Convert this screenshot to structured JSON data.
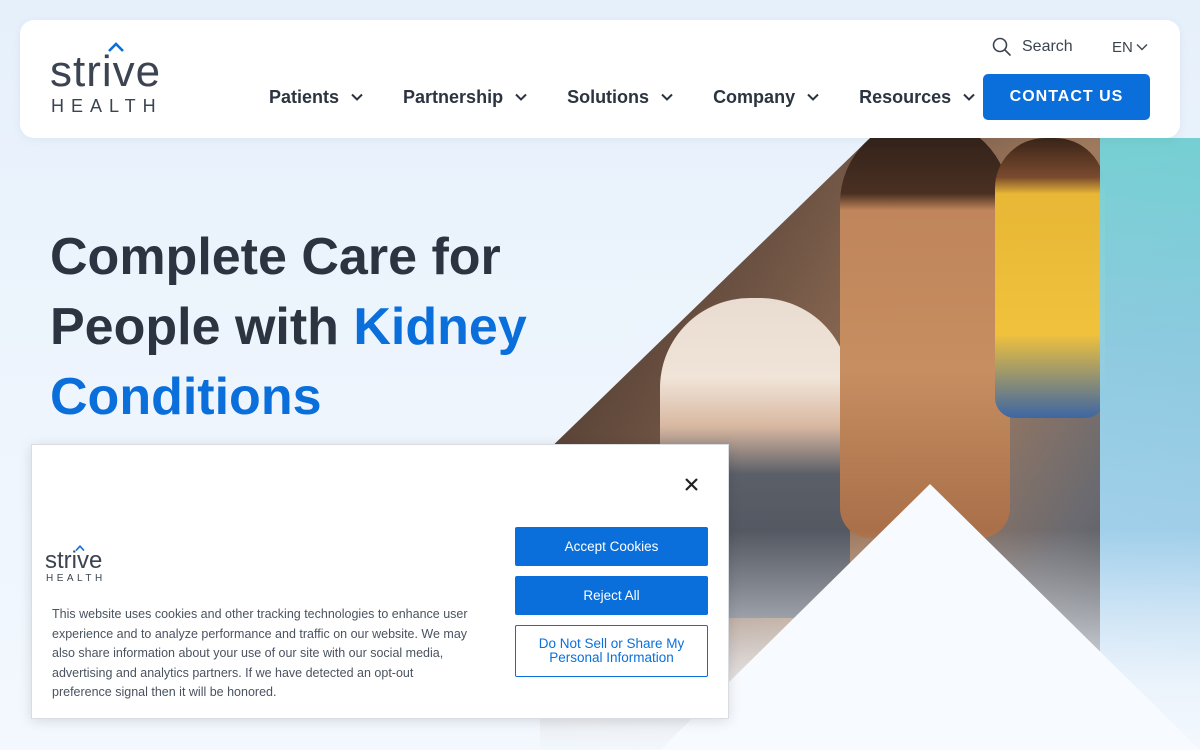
{
  "brand": {
    "word": "strive",
    "sub": "HEALTH",
    "accent_color": "#0a6fdb"
  },
  "header": {
    "search_label": "Search",
    "search_icon": "search-icon",
    "lang_label": "EN",
    "nav": [
      {
        "label": "Patients"
      },
      {
        "label": "Partnership"
      },
      {
        "label": "Solutions"
      },
      {
        "label": "Company"
      },
      {
        "label": "Resources"
      }
    ],
    "contact_label": "CONTACT US"
  },
  "hero": {
    "title_plain": "Complete Care for People with ",
    "title_highlight": "Kidney Conditions"
  },
  "cookie": {
    "close_icon": "close-icon",
    "text": "This website uses cookies and other tracking technologies to enhance user experience and to analyze performance and traffic on our website. We may also share information about your use of our site with our social media, advertising and analytics partners. If we have detected an opt-out preference signal then it will be honored.",
    "accept_label": "Accept Cookies",
    "reject_label": "Reject All",
    "do_not_sell_label": "Do Not Sell or Share My Personal Information"
  }
}
